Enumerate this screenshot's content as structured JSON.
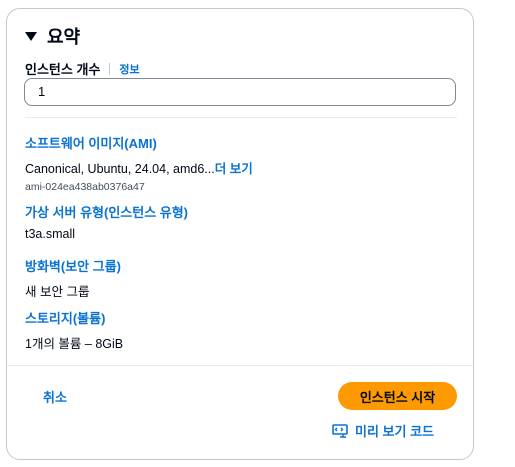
{
  "summary": {
    "title": "요약",
    "instance_count_label": "인스턴스 개수",
    "info_link": "정보",
    "instance_count_value": "1"
  },
  "sections": {
    "ami": {
      "heading": "소프트웨어 이미지(AMI)",
      "value": "Canonical, Ubuntu, 24.04, amd6...",
      "more_link": "더 보기",
      "id": "ami-024ea438ab0376a47"
    },
    "instance_type": {
      "heading": "가상 서버 유형(인스턴스 유형)",
      "value": "t3a.small"
    },
    "firewall": {
      "heading": "방화벽(보안 그룹)",
      "value": "새 보안 그룹"
    },
    "storage": {
      "heading": "스토리지(볼륨)",
      "value": "1개의 볼륨 – 8GiB"
    }
  },
  "actions": {
    "cancel": "취소",
    "launch": "인스턴스 시작",
    "preview_code": "미리 보기 코드"
  },
  "colors": {
    "link": "#0972d3",
    "primary_button": "#ff9900",
    "text": "#000716"
  }
}
